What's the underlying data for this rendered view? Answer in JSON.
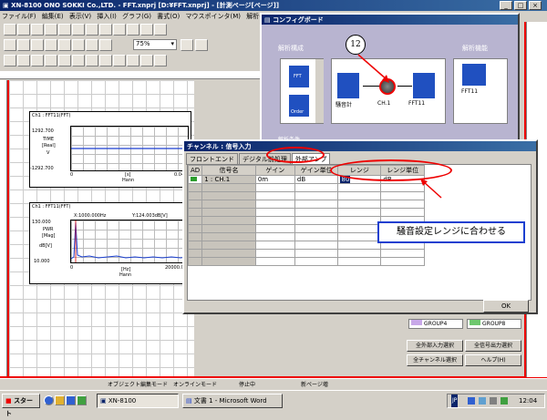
{
  "main_window": {
    "title": "XN-8100 ONO SOKKI Co.,LTD. - FFT.xnprj [D:¥FFT.xnprj] - [計測ページ[ページ]]",
    "menu": [
      "ファイル(F)",
      "編集(E)",
      "表示(V)",
      "挿入(I)",
      "グラフ(G)",
      "書式(O)",
      "マウスポインタ(M)",
      "解析(S)"
    ],
    "zoom": "75%"
  },
  "graph1": {
    "title": "Ch1 : FFT11(FFT)",
    "ymax": "1292.700",
    "ylabel1": "TIME",
    "ylabel2": "[Real]",
    "ymid": "V",
    "ymin": "-1292.700",
    "xmin": "0",
    "xlabel": "[s]",
    "xlabel2": "Hann",
    "xmax": "0.040"
  },
  "graph2": {
    "title": "Ch1 : FFT11(FFT)",
    "cursor": "X:1000.000Hz",
    "cursor_y": "Y:124.003dB[V]",
    "ymax": "130.000",
    "ylabel1": "PWR",
    "ylabel2": "[Mag]",
    "ylabel3": "dB[V]",
    "ymin": "10.000",
    "xmin": "0",
    "xlabel": "[Hz]",
    "xlabel2": "Hann",
    "xmax": "20000.000"
  },
  "config_board": {
    "title": "コンフィグボード",
    "analysis_section": "解析構成",
    "analysis_function": "解析機能",
    "analysis_condition": "解析条件",
    "modules": [
      {
        "label": "騒音計"
      },
      {
        "label": "CH.1"
      },
      {
        "label": "FFT11"
      }
    ],
    "function_module": "FFT11",
    "left_icons": [
      "FFT",
      "Order"
    ],
    "callout": "12"
  },
  "channel_dialog": {
    "title": "チャンネル : 信号入力",
    "tabs": [
      "フロントエンド",
      "デジタル前処理",
      "外部アンプ"
    ],
    "columns": [
      "AD",
      "信号名",
      "ゲイン",
      "ゲイン単位",
      "レンジ",
      "レンジ単位"
    ],
    "rows": [
      {
        "ad": "",
        "name": "1 : CH.1",
        "gain": "0m",
        "gain_unit": "dB",
        "range": "80",
        "range_unit": "dB"
      }
    ],
    "empty_rows": 10,
    "ok": "OK",
    "annotation": "騒音設定レンジに合わせる"
  },
  "right_panel": {
    "groups": [
      "GROUP4",
      "GROUP8"
    ],
    "buttons": [
      "全外部入力選択",
      "全信号出力選択",
      "全チャンネル選択",
      "ヘルプ(H)"
    ]
  },
  "statusbar": [
    "オブジェクト編集モード",
    "オンラインモード",
    "停止中",
    "新ページ増"
  ],
  "taskbar": {
    "start": "スタート",
    "tasks": [
      "XN-8100",
      "文書 1 - Microsoft Word"
    ],
    "clock": "12:04",
    "lang": "JP"
  },
  "colors": {
    "accent_red": "#e00000",
    "titlebar": "#0a246a",
    "module_blue": "#2050c0",
    "trace": "#1a3fd0",
    "desktop": "#d4d0c8"
  }
}
